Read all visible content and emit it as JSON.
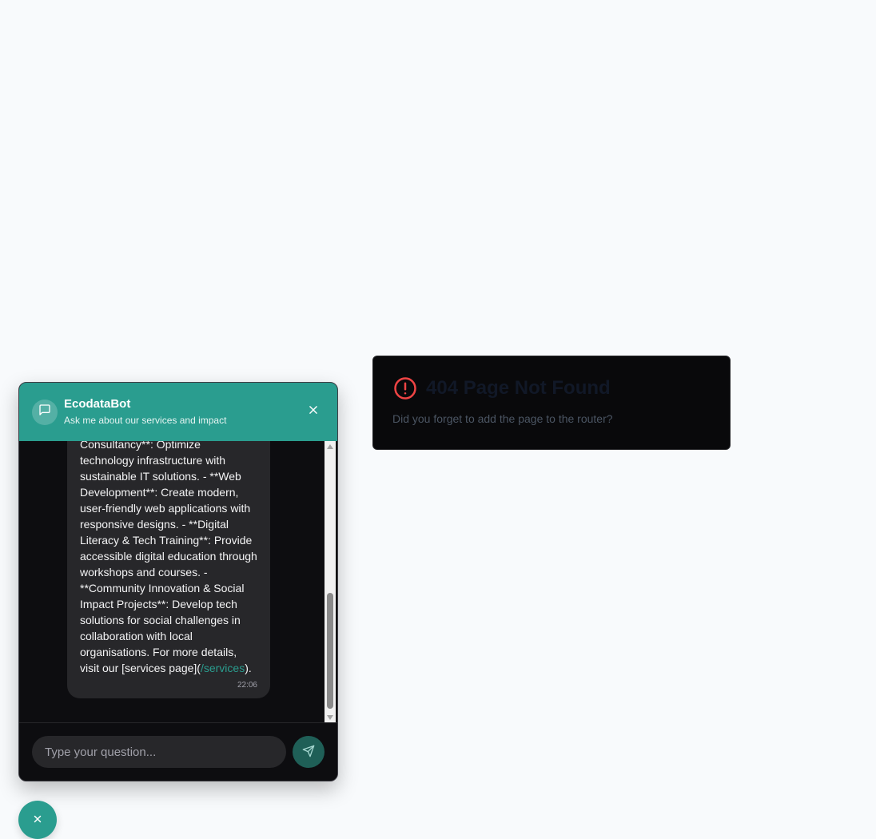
{
  "not_found": {
    "title": "404 Page Not Found",
    "description": "Did you forget to add the page to the router?",
    "icon": "alert-circle-icon",
    "icon_color": "#ef4444"
  },
  "chat": {
    "bot_name": "EcodataBot",
    "subtitle": "Ask me about our services and impact",
    "accent_color": "#2a9d8f",
    "message": {
      "text_before_link": "Consultancy**: Optimize technology infrastructure with sustainable IT solutions. - **Web Development**: Create modern, user-friendly web applications with responsive designs. - **Digital Literacy & Tech Training**: Provide accessible digital education through workshops and courses. - **Community Innovation & Social Impact Projects**: Develop tech solutions for social challenges in collaboration with local organisations. For more details, visit our [services page](",
      "link_text": "/services",
      "text_after_link": ").",
      "time": "22:06"
    },
    "input_placeholder": "Type your question..."
  }
}
